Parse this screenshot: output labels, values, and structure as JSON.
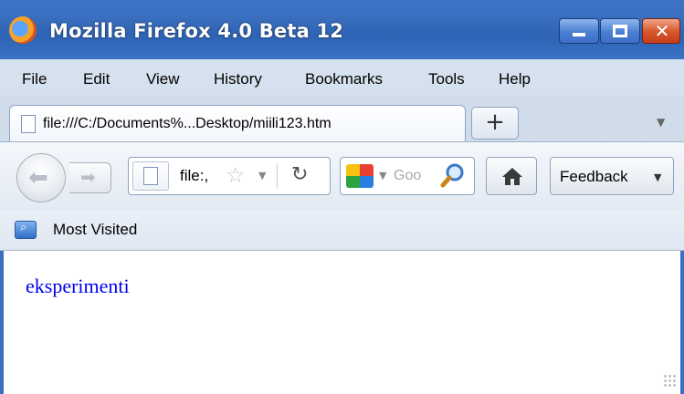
{
  "window": {
    "title": "Mozilla Firefox 4.0 Beta 12",
    "controls": {
      "minimize": "minimize",
      "maximize": "maximize",
      "close": "✕"
    }
  },
  "menu": [
    "File",
    "Edit",
    "View",
    "History",
    "Bookmarks",
    "Tools",
    "Help"
  ],
  "tabs": [
    {
      "label": "file:///C:/Documents%...Desktop/miili123.htm",
      "active": true
    }
  ],
  "new_tab_label": "+",
  "nav": {
    "url_text": "file:,",
    "search_placeholder": "Goo",
    "feedback_label": "Feedback"
  },
  "bookmarks": [
    {
      "label": "Most Visited"
    }
  ],
  "page": {
    "link_text": "eksperimenti"
  },
  "colors": {
    "titlebar": "#3a6fc0",
    "link": "#0000ee",
    "close_button": "#d85a2f"
  }
}
